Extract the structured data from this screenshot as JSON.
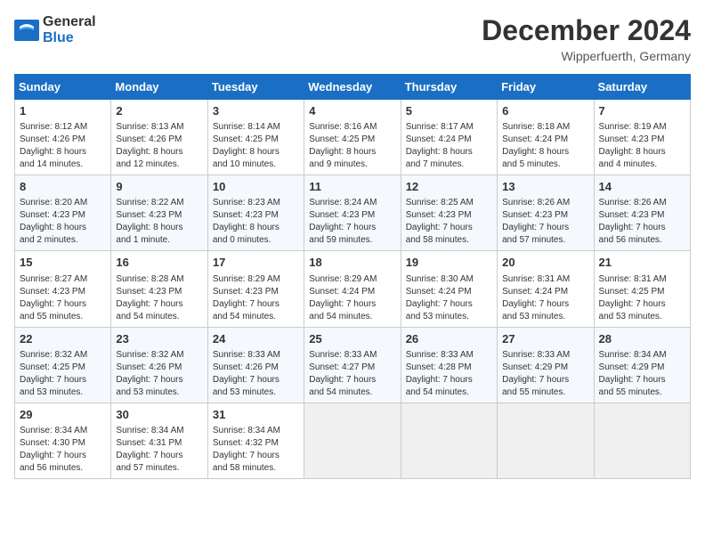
{
  "header": {
    "logo_line1": "General",
    "logo_line2": "Blue",
    "month": "December 2024",
    "location": "Wipperfuerth, Germany"
  },
  "weekdays": [
    "Sunday",
    "Monday",
    "Tuesday",
    "Wednesday",
    "Thursday",
    "Friday",
    "Saturday"
  ],
  "weeks": [
    [
      {
        "day": "1",
        "info": "Sunrise: 8:12 AM\nSunset: 4:26 PM\nDaylight: 8 hours\nand 14 minutes."
      },
      {
        "day": "2",
        "info": "Sunrise: 8:13 AM\nSunset: 4:26 PM\nDaylight: 8 hours\nand 12 minutes."
      },
      {
        "day": "3",
        "info": "Sunrise: 8:14 AM\nSunset: 4:25 PM\nDaylight: 8 hours\nand 10 minutes."
      },
      {
        "day": "4",
        "info": "Sunrise: 8:16 AM\nSunset: 4:25 PM\nDaylight: 8 hours\nand 9 minutes."
      },
      {
        "day": "5",
        "info": "Sunrise: 8:17 AM\nSunset: 4:24 PM\nDaylight: 8 hours\nand 7 minutes."
      },
      {
        "day": "6",
        "info": "Sunrise: 8:18 AM\nSunset: 4:24 PM\nDaylight: 8 hours\nand 5 minutes."
      },
      {
        "day": "7",
        "info": "Sunrise: 8:19 AM\nSunset: 4:23 PM\nDaylight: 8 hours\nand 4 minutes."
      }
    ],
    [
      {
        "day": "8",
        "info": "Sunrise: 8:20 AM\nSunset: 4:23 PM\nDaylight: 8 hours\nand 2 minutes."
      },
      {
        "day": "9",
        "info": "Sunrise: 8:22 AM\nSunset: 4:23 PM\nDaylight: 8 hours\nand 1 minute."
      },
      {
        "day": "10",
        "info": "Sunrise: 8:23 AM\nSunset: 4:23 PM\nDaylight: 8 hours\nand 0 minutes."
      },
      {
        "day": "11",
        "info": "Sunrise: 8:24 AM\nSunset: 4:23 PM\nDaylight: 7 hours\nand 59 minutes."
      },
      {
        "day": "12",
        "info": "Sunrise: 8:25 AM\nSunset: 4:23 PM\nDaylight: 7 hours\nand 58 minutes."
      },
      {
        "day": "13",
        "info": "Sunrise: 8:26 AM\nSunset: 4:23 PM\nDaylight: 7 hours\nand 57 minutes."
      },
      {
        "day": "14",
        "info": "Sunrise: 8:26 AM\nSunset: 4:23 PM\nDaylight: 7 hours\nand 56 minutes."
      }
    ],
    [
      {
        "day": "15",
        "info": "Sunrise: 8:27 AM\nSunset: 4:23 PM\nDaylight: 7 hours\nand 55 minutes."
      },
      {
        "day": "16",
        "info": "Sunrise: 8:28 AM\nSunset: 4:23 PM\nDaylight: 7 hours\nand 54 minutes."
      },
      {
        "day": "17",
        "info": "Sunrise: 8:29 AM\nSunset: 4:23 PM\nDaylight: 7 hours\nand 54 minutes."
      },
      {
        "day": "18",
        "info": "Sunrise: 8:29 AM\nSunset: 4:24 PM\nDaylight: 7 hours\nand 54 minutes."
      },
      {
        "day": "19",
        "info": "Sunrise: 8:30 AM\nSunset: 4:24 PM\nDaylight: 7 hours\nand 53 minutes."
      },
      {
        "day": "20",
        "info": "Sunrise: 8:31 AM\nSunset: 4:24 PM\nDaylight: 7 hours\nand 53 minutes."
      },
      {
        "day": "21",
        "info": "Sunrise: 8:31 AM\nSunset: 4:25 PM\nDaylight: 7 hours\nand 53 minutes."
      }
    ],
    [
      {
        "day": "22",
        "info": "Sunrise: 8:32 AM\nSunset: 4:25 PM\nDaylight: 7 hours\nand 53 minutes."
      },
      {
        "day": "23",
        "info": "Sunrise: 8:32 AM\nSunset: 4:26 PM\nDaylight: 7 hours\nand 53 minutes."
      },
      {
        "day": "24",
        "info": "Sunrise: 8:33 AM\nSunset: 4:26 PM\nDaylight: 7 hours\nand 53 minutes."
      },
      {
        "day": "25",
        "info": "Sunrise: 8:33 AM\nSunset: 4:27 PM\nDaylight: 7 hours\nand 54 minutes."
      },
      {
        "day": "26",
        "info": "Sunrise: 8:33 AM\nSunset: 4:28 PM\nDaylight: 7 hours\nand 54 minutes."
      },
      {
        "day": "27",
        "info": "Sunrise: 8:33 AM\nSunset: 4:29 PM\nDaylight: 7 hours\nand 55 minutes."
      },
      {
        "day": "28",
        "info": "Sunrise: 8:34 AM\nSunset: 4:29 PM\nDaylight: 7 hours\nand 55 minutes."
      }
    ],
    [
      {
        "day": "29",
        "info": "Sunrise: 8:34 AM\nSunset: 4:30 PM\nDaylight: 7 hours\nand 56 minutes."
      },
      {
        "day": "30",
        "info": "Sunrise: 8:34 AM\nSunset: 4:31 PM\nDaylight: 7 hours\nand 57 minutes."
      },
      {
        "day": "31",
        "info": "Sunrise: 8:34 AM\nSunset: 4:32 PM\nDaylight: 7 hours\nand 58 minutes."
      },
      null,
      null,
      null,
      null
    ]
  ]
}
